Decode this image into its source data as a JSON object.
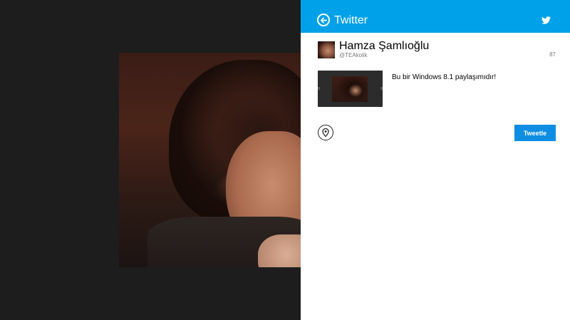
{
  "panel": {
    "title": "Twitter",
    "accent_color": "#00a1e9",
    "back_icon": "back-arrow-icon",
    "brand_icon": "twitter-bird-icon"
  },
  "account": {
    "name": "Hamza Şamlıoğlu",
    "handle": "@TEAkolik",
    "remaining_chars": "87"
  },
  "post": {
    "message": "Bu bir Windows 8.1 paylaşımıdır!",
    "location_icon": "location-pin-icon",
    "submit_label": "Tweetle",
    "submit_color": "#0e8ee3"
  }
}
